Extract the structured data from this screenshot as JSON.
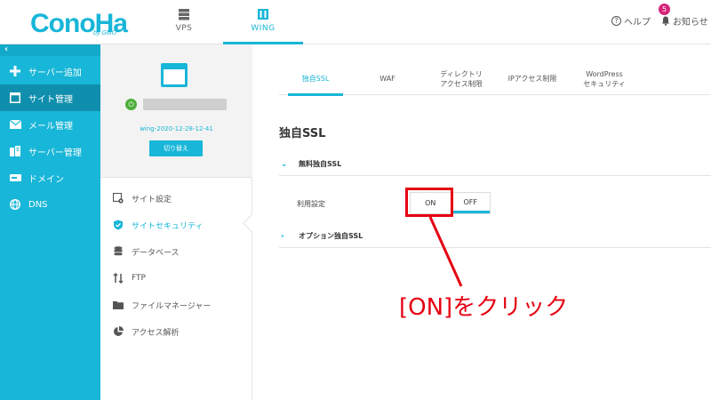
{
  "header": {
    "logo_text": "ConoHa",
    "logo_sub": "by GMO",
    "tabs": [
      {
        "label": "VPS",
        "icon": "server-stack-icon"
      },
      {
        "label": "WING",
        "icon": "building-icon"
      }
    ],
    "help_label": "ヘルプ",
    "notify_label": "お知らせ",
    "notify_count": "5"
  },
  "sidebar": {
    "collapse": "‹",
    "items": [
      {
        "label": "サーバー追加",
        "icon": "plus-icon"
      },
      {
        "label": "サイト管理",
        "icon": "window-icon"
      },
      {
        "label": "メール管理",
        "icon": "mail-icon"
      },
      {
        "label": "サーバー管理",
        "icon": "server-icon"
      },
      {
        "label": "ドメイン",
        "icon": "domain-icon"
      },
      {
        "label": "DNS",
        "icon": "globe-icon"
      }
    ]
  },
  "server_panel": {
    "server_name": "wing-2020-12-28-12-41",
    "switch_label": "切り替え",
    "menu": [
      {
        "label": "サイト設定",
        "icon": "site-settings-icon"
      },
      {
        "label": "サイトセキュリティ",
        "icon": "shield-check-icon"
      },
      {
        "label": "データベース",
        "icon": "database-icon"
      },
      {
        "label": "FTP",
        "icon": "transfer-arrows-icon"
      },
      {
        "label": "ファイルマネージャー",
        "icon": "folder-icon"
      },
      {
        "label": "アクセス解析",
        "icon": "pie-chart-icon"
      }
    ]
  },
  "main": {
    "tabs": [
      {
        "label": "独自SSL"
      },
      {
        "label": "WAF"
      },
      {
        "label": "ディレクトリ\nアクセス制限"
      },
      {
        "label": "IPアクセス制限"
      },
      {
        "label": "WordPress\nセキュリティ"
      }
    ],
    "title": "独自SSL",
    "free_ssl_label": "無料独自SSL",
    "setting_label": "利用設定",
    "toggle_on": "ON",
    "toggle_off": "OFF",
    "option_ssl_label": "オプション独自SSL"
  },
  "annotation": {
    "text": "[ON]をクリック",
    "color": "#e60012"
  },
  "colors": {
    "accent": "#18b6d8",
    "sidebar_active": "#0f8fad",
    "power_on": "#4cae3a",
    "badge": "#d6247a"
  }
}
